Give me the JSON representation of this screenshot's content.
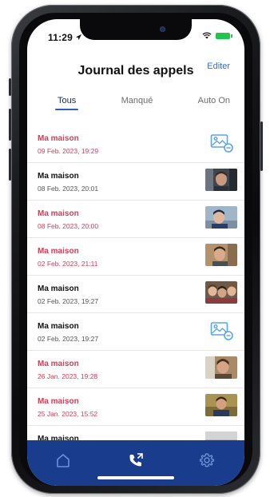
{
  "status_bar": {
    "time": "11:29"
  },
  "header": {
    "title": "Journal des appels",
    "edit_label": "Editer"
  },
  "tabs": [
    {
      "label": "Tous",
      "active": true
    },
    {
      "label": "Manqué",
      "active": false
    },
    {
      "label": "Auto On",
      "active": false
    }
  ],
  "calls": [
    {
      "name": "Ma maison",
      "date": "09 Feb. 2023, 19:29",
      "missed": true,
      "thumbnail": "no-image-placeholder"
    },
    {
      "name": "Ma maison",
      "date": "08 Feb. 2023, 20:01",
      "missed": false,
      "thumbnail": "photo"
    },
    {
      "name": "Ma maison",
      "date": "08 Feb. 2023, 20:00",
      "missed": true,
      "thumbnail": "photo"
    },
    {
      "name": "Ma maison",
      "date": "02 Feb. 2023, 21:11",
      "missed": true,
      "thumbnail": "photo"
    },
    {
      "name": "Ma maison",
      "date": "02 Feb. 2023, 19:27",
      "missed": false,
      "thumbnail": "photo"
    },
    {
      "name": "Ma maison",
      "date": "02 Feb. 2023, 19:27",
      "missed": false,
      "thumbnail": "no-image-placeholder"
    },
    {
      "name": "Ma maison",
      "date": "26 Jan. 2023, 19:28",
      "missed": true,
      "thumbnail": "photo"
    },
    {
      "name": "Ma maison",
      "date": "25 Jan. 2023, 15:52",
      "missed": true,
      "thumbnail": "photo"
    },
    {
      "name": "Ma maison",
      "date": "",
      "missed": false,
      "thumbnail": "photo"
    }
  ],
  "bottom_nav": [
    {
      "icon": "home-icon",
      "active": false
    },
    {
      "icon": "call-log-icon",
      "active": true
    },
    {
      "icon": "settings-icon",
      "active": false
    }
  ],
  "colors": {
    "missed": "#d83a55",
    "accent": "#2d5ec2",
    "nav_bg": "#1a3c8c",
    "battery": "#1ec64e"
  }
}
